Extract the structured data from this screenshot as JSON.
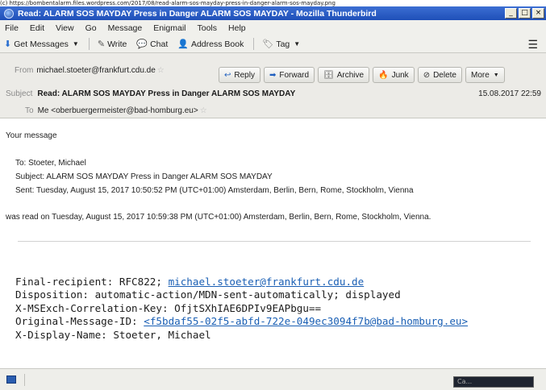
{
  "window": {
    "url_strip": "(c) https://bombentalarm.files.wordpress.com/2017/08/read-alarm-sos-mayday-press-in-danger-alarm-sos-mayday.png",
    "title": "Read: ALARM SOS MAYDAY Press in Danger ALARM SOS MAYDAY - Mozilla Thunderbird",
    "controls": [
      "_",
      "□",
      "×"
    ]
  },
  "menu": [
    "File",
    "Edit",
    "View",
    "Go",
    "Message",
    "Enigmail",
    "Tools",
    "Help"
  ],
  "toolbar": {
    "get_messages": "Get Messages",
    "write": "Write",
    "chat": "Chat",
    "address_book": "Address Book",
    "tag": "Tag"
  },
  "header": {
    "from_label": "From",
    "from_value": "michael.stoeter@frankfurt.cdu.de",
    "subject_label": "Subject",
    "subject_value": "Read: ALARM SOS MAYDAY Press in Danger ALARM SOS MAYDAY",
    "date": "15.08.2017 22:59",
    "to_label": "To",
    "to_value": "Me <oberbuergermeister@bad-homburg.eu>",
    "buttons": {
      "reply": "Reply",
      "forward": "Forward",
      "archive": "Archive",
      "junk": "Junk",
      "delete": "Delete",
      "more": "More"
    }
  },
  "message": {
    "intro": "Your message",
    "to_line": "To: Stoeter, Michael",
    "subject_line": "Subject: ALARM SOS MAYDAY Press in Danger ALARM SOS MAYDAY",
    "sent_line": "Sent: Tuesday, August 15, 2017 10:50:52 PM (UTC+01:00) Amsterdam, Berlin, Bern, Rome, Stockholm, Vienna",
    "read_line": "was read on Tuesday, August 15, 2017 10:59:38 PM (UTC+01:00) Amsterdam, Berlin, Bern, Rome, Stockholm, Vienna."
  },
  "mdn": {
    "final_recipient_label": "Final-recipient: RFC822; ",
    "final_recipient_email": "michael.stoeter@frankfurt.cdu.de",
    "disposition": "Disposition: automatic-action/MDN-sent-automatically; displayed",
    "correlation": "X-MSExch-Correlation-Key: OfjtSXhIAE6DPIv9EAPbgu==",
    "original_id_label": "Original-Message-ID: ",
    "original_id_value": "<f5bdaf55-02f5-abfd-722e-049ec3094f7b@bad-homburg.eu>",
    "display_name": "X-Display-Name: Stoeter, Michael"
  },
  "status": {
    "box_text": "Ca..."
  }
}
